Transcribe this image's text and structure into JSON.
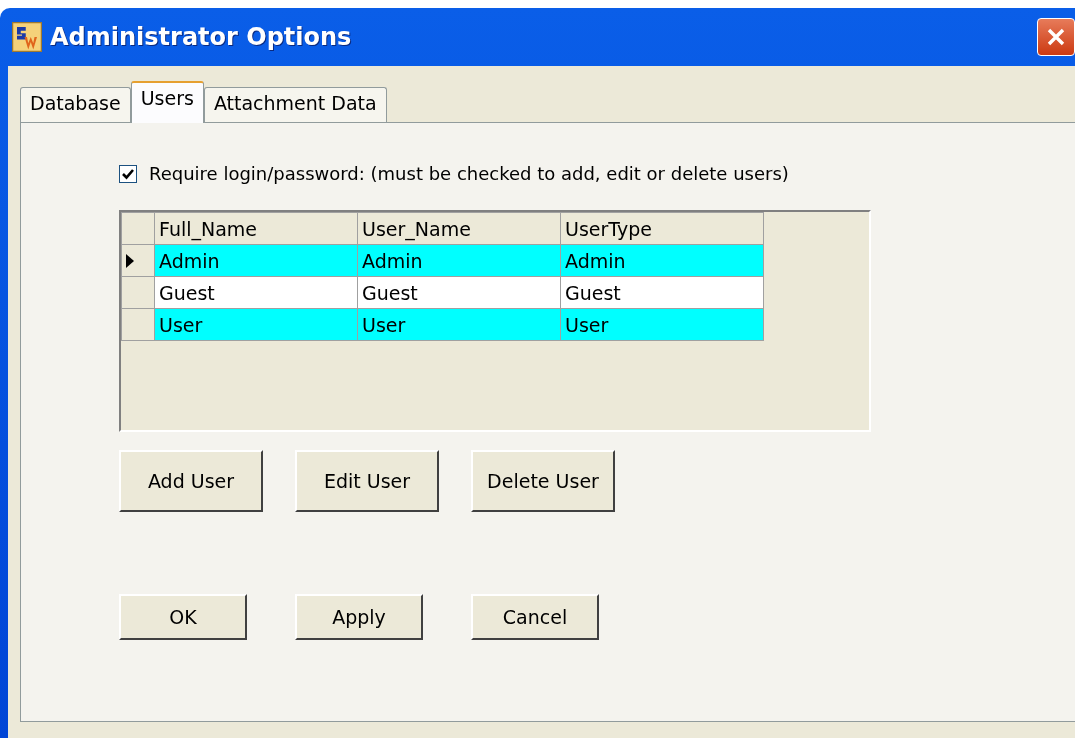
{
  "window": {
    "title": "Administrator Options"
  },
  "tabs": [
    {
      "label": "Database",
      "selected": false
    },
    {
      "label": "Users",
      "selected": true
    },
    {
      "label": "Attachment Data",
      "selected": false
    }
  ],
  "require_login": {
    "label": "Require login/password: (must be checked to add, edit or delete users)",
    "checked": true
  },
  "table": {
    "columns": [
      "Full_Name",
      "User_Name",
      "UserType"
    ],
    "rows": [
      {
        "cells": [
          "Admin",
          "Admin",
          "Admin"
        ],
        "selected": true,
        "color": "#00ffff"
      },
      {
        "cells": [
          "Guest",
          "Guest",
          "Guest"
        ],
        "selected": false,
        "color": "#ffffff"
      },
      {
        "cells": [
          "User",
          "User",
          "User"
        ],
        "selected": false,
        "color": "#00ffff"
      }
    ]
  },
  "user_buttons": [
    "Add User",
    "Edit User",
    "Delete User"
  ],
  "dialog_buttons": [
    "OK",
    "Apply",
    "Cancel"
  ]
}
